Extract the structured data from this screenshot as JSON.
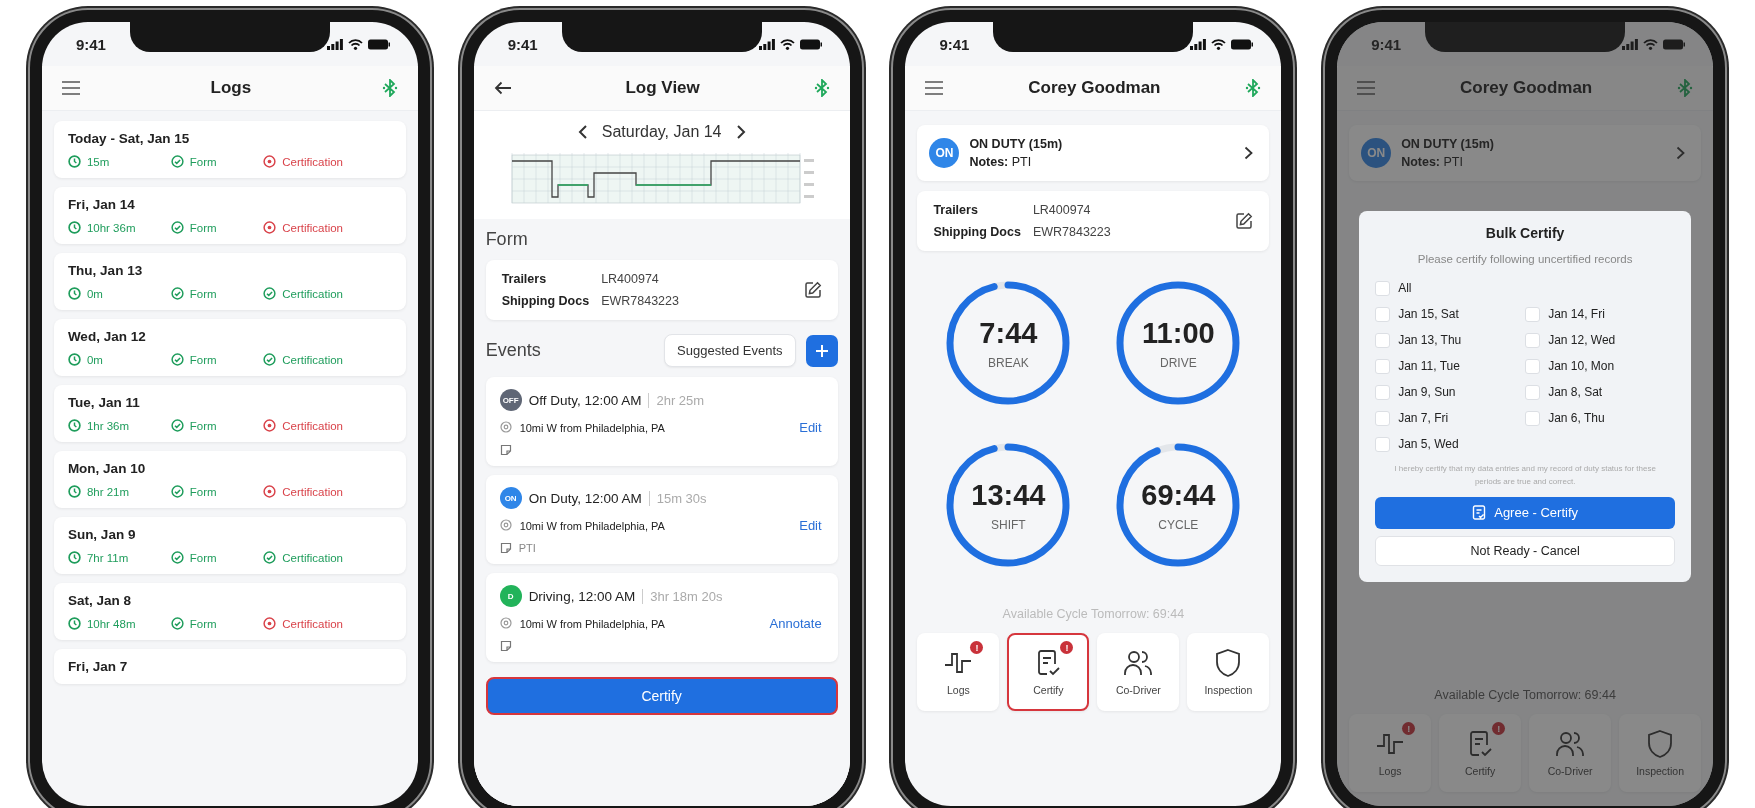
{
  "logs_screen": {
    "status_time": "9:41",
    "title": "Logs",
    "logs": [
      {
        "date": "Today - Sat, Jan 15",
        "duration": "15m",
        "form": "Form",
        "form_done": true,
        "certification": "Certification",
        "certified": false
      },
      {
        "date": "Fri, Jan 14",
        "duration": "10hr 36m",
        "form": "Form",
        "form_done": true,
        "certification": "Certification",
        "certified": false
      },
      {
        "date": "Thu, Jan 13",
        "duration": "0m",
        "form": "Form",
        "form_done": true,
        "certification": "Certification",
        "certified": true
      },
      {
        "date": "Wed, Jan 12",
        "duration": "0m",
        "form": "Form",
        "form_done": true,
        "certification": "Certification",
        "certified": true
      },
      {
        "date": "Tue, Jan 11",
        "duration": "1hr 36m",
        "form": "Form",
        "form_done": true,
        "certification": "Certification",
        "certified": false
      },
      {
        "date": "Mon, Jan 10",
        "duration": "8hr 21m",
        "form": "Form",
        "form_done": true,
        "certification": "Certification",
        "certified": false
      },
      {
        "date": "Sun, Jan 9",
        "duration": "7hr 11m",
        "form": "Form",
        "form_done": true,
        "certification": "Certification",
        "certified": true
      },
      {
        "date": "Sat, Jan 8",
        "duration": "10hr 48m",
        "form": "Form",
        "form_done": true,
        "certification": "Certification",
        "certified": false
      },
      {
        "date": "Fri, Jan 7"
      }
    ]
  },
  "log_view_screen": {
    "status_time": "9:41",
    "title": "Log View",
    "date": "Saturday, Jan 14",
    "form_heading": "Form",
    "form_fields": [
      {
        "label": "Trailers",
        "value": "LR400974"
      },
      {
        "label": "Shipping Docs",
        "value": "EWR7843223"
      }
    ],
    "events_heading": "Events",
    "suggested_button": "Suggested Events",
    "events": [
      {
        "badge": "OFF",
        "color": "#5f6675",
        "title": "Off Duty, 12:00 AM",
        "duration": "2hr 25m",
        "location": "10mi W from Philadelphia, PA",
        "action": "Edit"
      },
      {
        "badge": "ON",
        "color": "#2f86e8",
        "title": "On Duty, 12:00 AM",
        "duration": "15m 30s",
        "location": "10mi W from Philadelphia, PA",
        "action": "Edit",
        "note": "PTI"
      },
      {
        "badge": "D",
        "color": "#22b35a",
        "title": "Driving, 12:00 AM",
        "duration": "3hr 18m 20s",
        "location": "10mi W from Philadelphia, PA",
        "action": "Annotate"
      }
    ],
    "certify_button": {
      "label": "Certify",
      "highlighted": true
    }
  },
  "dashboard_screen": {
    "status_time": "9:41",
    "title": "Corey Goodman",
    "status": {
      "badge": "ON",
      "label": "ON DUTY (15m)",
      "notes_label": "Notes:",
      "notes": "PTI"
    },
    "form_fields": [
      {
        "label": "Trailers",
        "value": "LR400974"
      },
      {
        "label": "Shipping Docs",
        "value": "EWR7843223"
      }
    ],
    "clocks": [
      {
        "time": "7:44",
        "label": "BREAK",
        "level": 0.96
      },
      {
        "time": "11:00",
        "label": "DRIVE",
        "level": 1
      },
      {
        "time": "13:44",
        "label": "SHIFT",
        "level": 0.96
      },
      {
        "time": "69:44",
        "label": "CYCLE",
        "level": 0.94
      }
    ],
    "available": "Available Cycle Tomorrow: 69:44",
    "tabs": [
      {
        "kind": "logs",
        "label": "Logs",
        "badge": "!",
        "highlighted": false
      },
      {
        "kind": "certify",
        "label": "Certify",
        "badge": "!",
        "highlighted": true
      },
      {
        "kind": "co_driver",
        "label": "Co-Driver",
        "highlighted": false
      },
      {
        "kind": "inspection",
        "label": "Inspection",
        "highlighted": false
      }
    ]
  },
  "certify_screen": {
    "status_time": "9:41",
    "title": "Corey Goodman",
    "status": {
      "badge": "ON",
      "label": "ON DUTY (15m)",
      "notes_label": "Notes:",
      "notes": "PTI"
    },
    "available": "Available Cycle Tomorrow: 69:44",
    "tabs": [
      {
        "kind": "logs",
        "label": "Logs",
        "badge": "!",
        "highlighted": false
      },
      {
        "kind": "certify",
        "label": "Certify",
        "badge": "!",
        "highlighted": false
      },
      {
        "kind": "co_driver",
        "label": "Co-Driver",
        "highlighted": false
      },
      {
        "kind": "inspection",
        "label": "Inspection",
        "highlighted": false
      }
    ],
    "dialog": {
      "title": "Bulk Certify",
      "subtitle": "Please certify following uncertified records",
      "all": {
        "label": "All",
        "checked": false
      },
      "days": [
        {
          "label": "Jan 15, Sat",
          "checked": false
        },
        {
          "label": "Jan 14, Fri",
          "checked": false
        },
        {
          "label": "Jan 13, Thu",
          "checked": false
        },
        {
          "label": "Jan 12, Wed",
          "checked": false
        },
        {
          "label": "Jan 11, Tue",
          "checked": false
        },
        {
          "label": "Jan 10, Mon",
          "checked": false
        },
        {
          "label": "Jan 9, Sun",
          "checked": false
        },
        {
          "label": "Jan 8, Sat",
          "checked": false
        },
        {
          "label": "Jan 7, Fri",
          "checked": false
        },
        {
          "label": "Jan 6, Thu",
          "checked": false
        },
        {
          "label": "Jan 5, Wed",
          "checked": false
        }
      ],
      "disclaimer": "I hereby certify that my data entries and my record of duty status for these periods are true and correct.",
      "agree_button": "Agree - Certify",
      "cancel_button": "Not Ready - Cancel"
    }
  }
}
